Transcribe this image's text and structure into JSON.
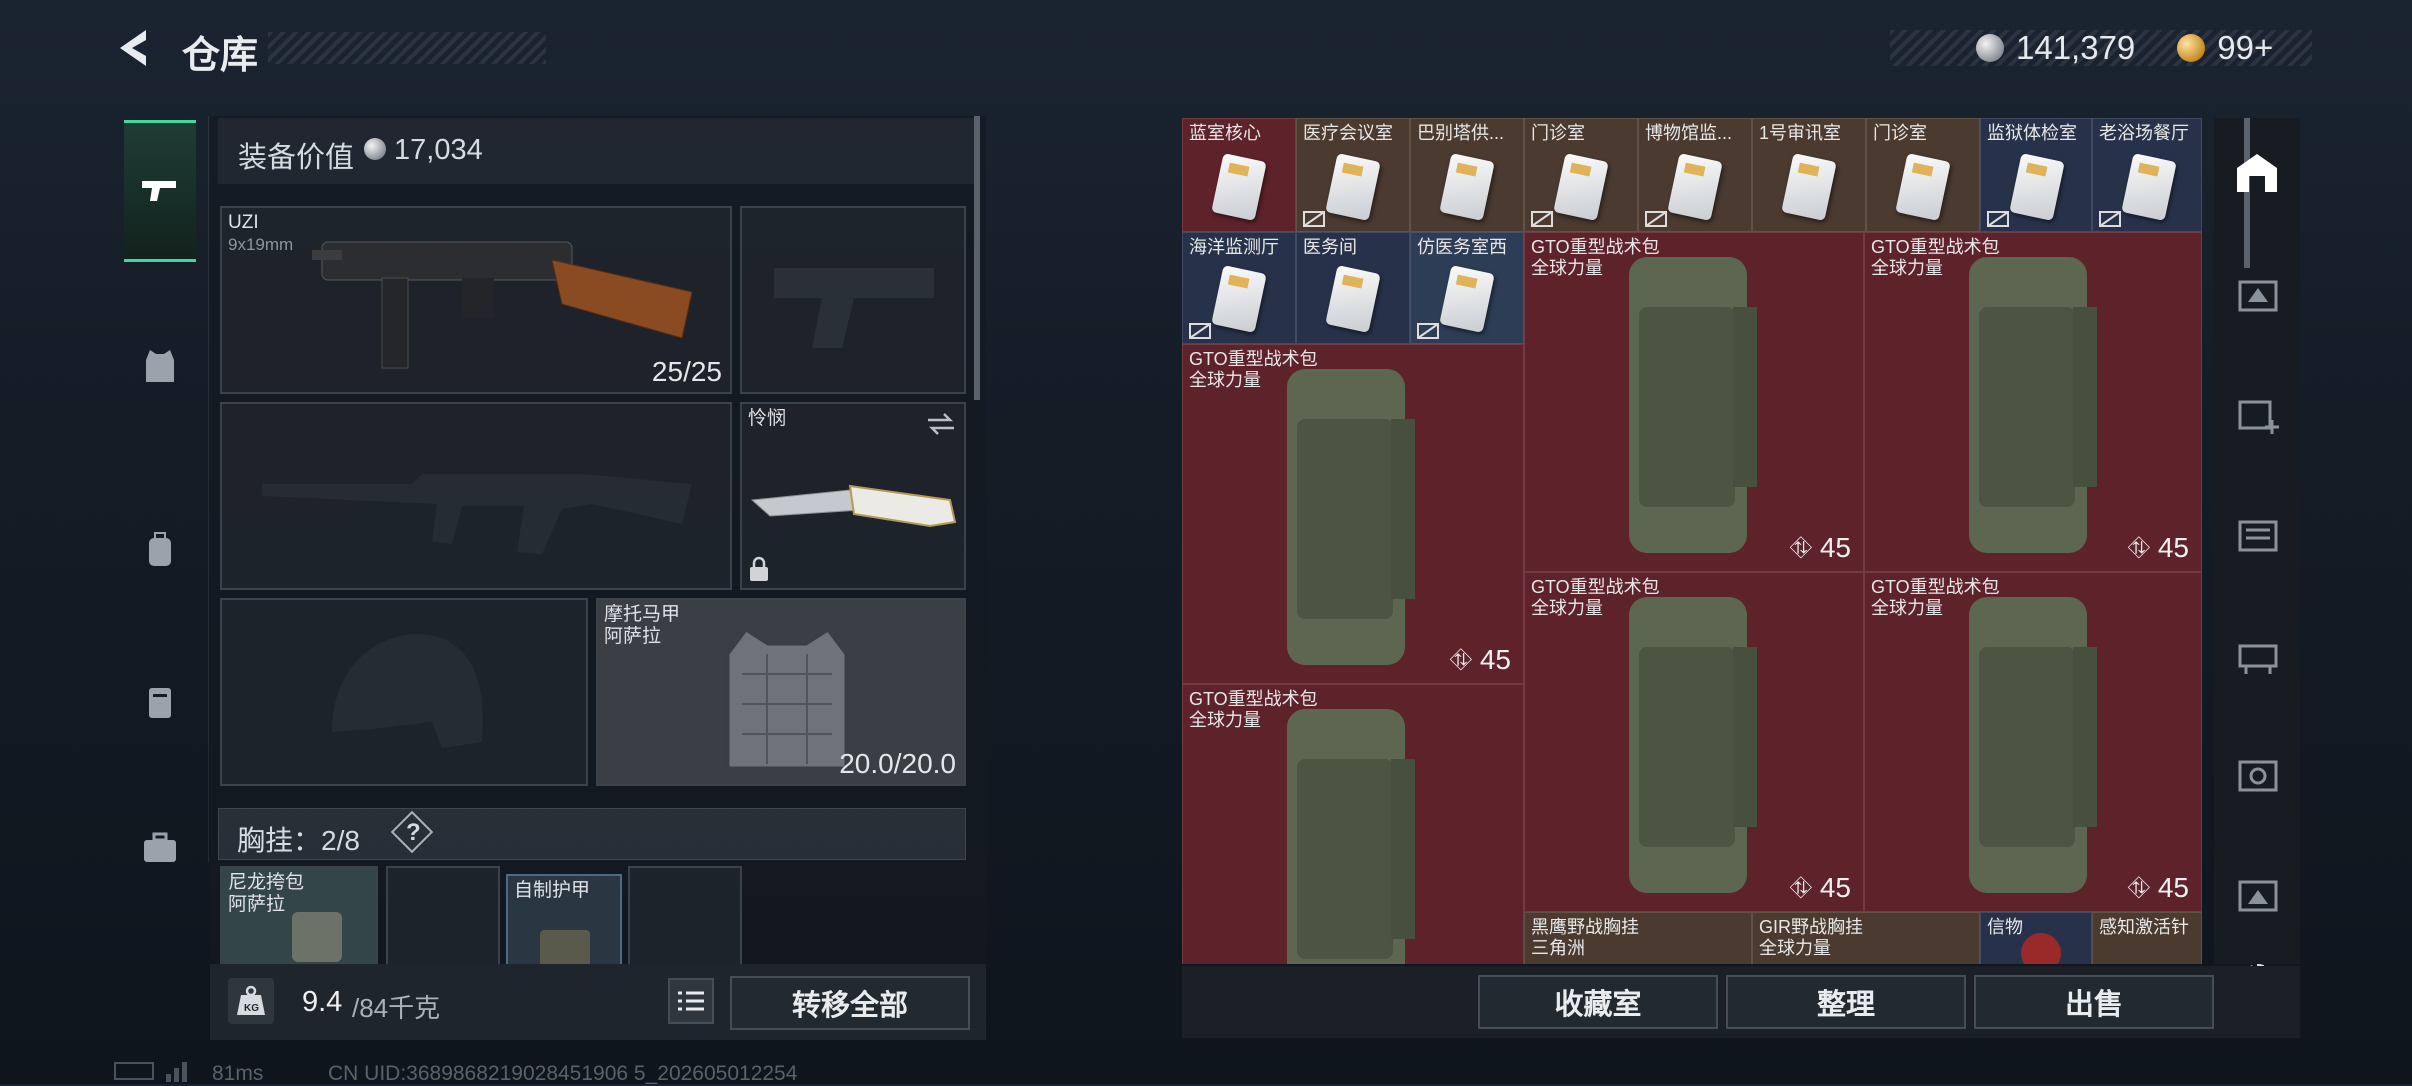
{
  "header": {
    "title": "仓库",
    "silver_amount": "141,379",
    "gold_amount": "99+"
  },
  "equipment": {
    "value_label": "装备价值",
    "value": "17,034",
    "primary_weapon": {
      "name": "UZI",
      "ammo_type": "9x19mm",
      "ammo": "25/25"
    },
    "melee": {
      "name": "怜悯"
    },
    "armor": {
      "name": "摩托马甲",
      "brand": "阿萨拉",
      "durability": "20.0/20.0"
    },
    "chest_rig_label": "胸挂：2/8",
    "help": "?",
    "pouches": [
      {
        "name": "尼龙挎包",
        "brand": "阿萨拉"
      },
      {
        "name": ""
      },
      {
        "name": "自制护甲"
      },
      {
        "name": ""
      }
    ]
  },
  "bottom_left": {
    "weight_current": "9.4",
    "weight_total": "/84千克",
    "transfer_all": "转移全部"
  },
  "stash": {
    "keycards_row1": [
      "蓝室核心",
      "医疗会议室",
      "巴别塔供...",
      "门诊室",
      "博物馆监...",
      "1号审讯室",
      "门诊室",
      "监狱体检室",
      "老浴场餐厅"
    ],
    "keycards_row2": [
      "海洋监测厅",
      "医务间",
      "仿医务室西"
    ],
    "backpacks": [
      {
        "name": "GTO重型战术包",
        "brand": "全球力量",
        "weight": "45"
      },
      {
        "name": "GTO重型战术包",
        "brand": "全球力量",
        "weight": "45"
      },
      {
        "name": "GTO重型战术包",
        "brand": "全球力量",
        "weight": "45"
      },
      {
        "name": "GTO重型战术包",
        "brand": "全球力量",
        "weight": "45"
      },
      {
        "name": "GTO重型战术包",
        "brand": "全球力量",
        "weight": "45"
      },
      {
        "name": "GTO重型战术包",
        "brand": "全球力量",
        "weight": ""
      }
    ],
    "bottom_items": [
      {
        "name": "黑鹰野战胸挂",
        "brand": "三角洲"
      },
      {
        "name": "GIR野战胸挂",
        "brand": "全球力量"
      },
      {
        "name": "信物",
        "brand": ""
      },
      {
        "name": "感知激活针",
        "brand": ""
      }
    ]
  },
  "actions": {
    "collection": "收藏室",
    "sort": "整理",
    "sell": "出售"
  },
  "status": {
    "ping": "81ms",
    "uid": "CN UID:3689868219028451906 5_202605012254"
  },
  "colors": {
    "accent": "#3fd8a0",
    "stash_red": "#5e222a",
    "stash_blue": "#27324a"
  }
}
